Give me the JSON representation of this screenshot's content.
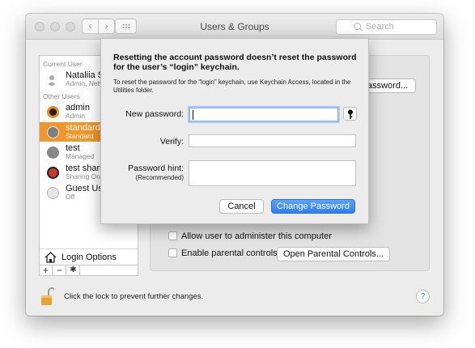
{
  "window": {
    "title": "Users & Groups",
    "search_placeholder": "Search"
  },
  "sidebar": {
    "current_user_header": "Current User",
    "other_users_header": "Other Users",
    "users": [
      {
        "name": "Nataliia Sc",
        "sub": "Admin, Netw",
        "avatar": "blank-user-icon"
      },
      {
        "name": "admin",
        "sub": "Admin",
        "avatar": "target-avatar"
      },
      {
        "name": "standard",
        "sub": "Standard",
        "avatar": "gray-avatar",
        "selected": true
      },
      {
        "name": "test",
        "sub": "Managed",
        "avatar": "gray-avatar"
      },
      {
        "name": "test sharin",
        "sub": "Sharing On",
        "avatar": "flower-avatar"
      },
      {
        "name": "Guest Use",
        "sub": "Off",
        "avatar": "guest-avatar"
      }
    ],
    "login_options": "Login Options",
    "add_label": "+",
    "remove_label": "−",
    "gear_label": "✱"
  },
  "main": {
    "password_button": "assword...",
    "allow_admin_label": "Allow user to administer this computer",
    "parental_label": "Enable parental controls",
    "parental_button": "Open Parental Controls..."
  },
  "footer": {
    "lock_text": "Click the lock to prevent further changes.",
    "help_label": "?"
  },
  "dialog": {
    "title": "Resetting the account password doesn’t reset the password for the user’s “login” keychain.",
    "description": "To reset the password for the “login” keychain, use Keychain Access, located in the Utilities folder.",
    "new_password_label": "New password:",
    "verify_label": "Verify:",
    "hint_label": "Password hint:",
    "hint_sublabel": "(Recommended)",
    "new_password_value": "",
    "verify_value": "",
    "hint_value": "",
    "cancel_label": "Cancel",
    "confirm_label": "Change Password",
    "accent_color": "#2f7ef5",
    "selection_color": "#f0962a"
  }
}
